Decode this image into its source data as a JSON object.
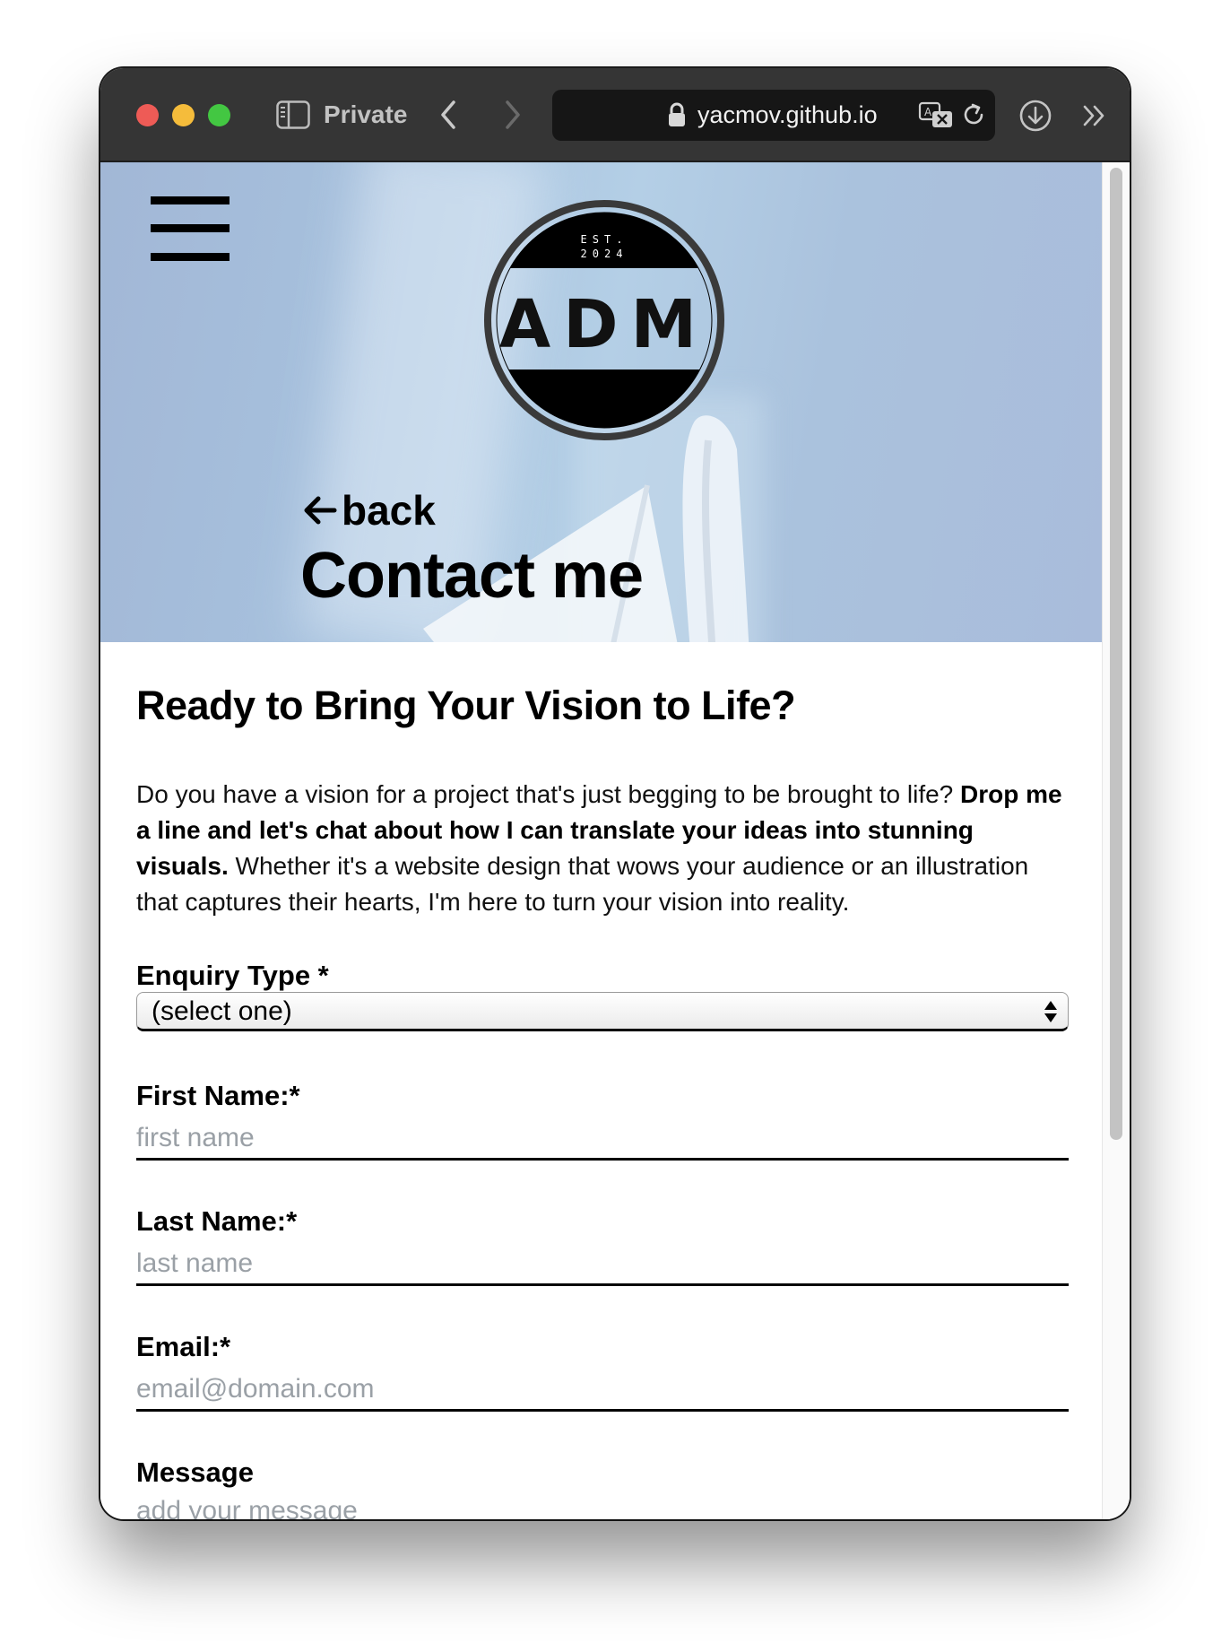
{
  "browser": {
    "mode_label": "Private",
    "url": "yacmov.github.io"
  },
  "hero": {
    "logo": {
      "est_line1": "EST.",
      "est_line2": "2024",
      "initials": "ADM"
    },
    "back_label": "back",
    "title": "Contact me"
  },
  "content": {
    "heading": "Ready to Bring Your Vision to Life?",
    "intro_part1": "Do you have a vision for a project that's just begging to be brought to life? ",
    "intro_bold": "Drop me a line and let's chat about how I can translate your ideas into stunning visuals.",
    "intro_part2": " Whether it's a website design that wows your audience or an illustration that captures their hearts, I'm here to turn your vision into reality."
  },
  "form": {
    "enquiry_label": "Enquiry Type *",
    "enquiry_value": "(select one)",
    "first_name_label": "First Name:*",
    "first_name_placeholder": "first name",
    "last_name_label": "Last Name:*",
    "last_name_placeholder": "last name",
    "email_label": "Email:*",
    "email_placeholder": "email@domain.com",
    "message_label": "Message",
    "message_placeholder": "add your message"
  },
  "colors": {
    "toolbar": "#353535",
    "hero_bg": "#a7c2de",
    "traffic_red": "#ee5b56",
    "traffic_yellow": "#f5bc3b",
    "traffic_green": "#43c742",
    "placeholder": "#9aa0a6"
  }
}
